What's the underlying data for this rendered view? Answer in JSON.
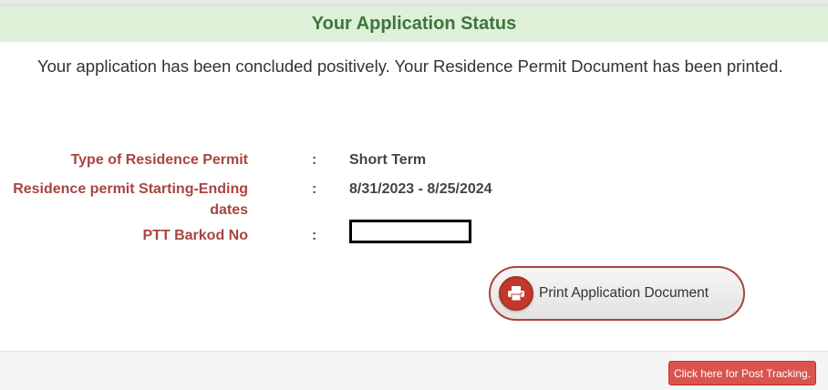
{
  "header": {
    "title": "Your Application Status"
  },
  "message": "Your application has been concluded positively. Your Residence Permit Document has been printed.",
  "details": [
    {
      "label": "Type of Residence Permit",
      "separator": ":",
      "value": "Short Term"
    },
    {
      "label_line1": "Residence permit Starting-Ending",
      "label_line2": "dates",
      "separator": ":",
      "value": "8/31/2023 - 8/25/2024"
    },
    {
      "label": "PTT Barkod No",
      "separator": ":",
      "value_redacted": true
    }
  ],
  "print_button": {
    "label": "Print Application Document",
    "icon": "printer-icon"
  },
  "footer": {
    "track_button_label": "Click here for Post Tracking."
  },
  "colors": {
    "header_bg": "#dff0d8",
    "header_text": "#3c763d",
    "label_text": "#a94442",
    "print_icon_bg": "#c0392b",
    "track_button_bg": "#d9534f"
  }
}
